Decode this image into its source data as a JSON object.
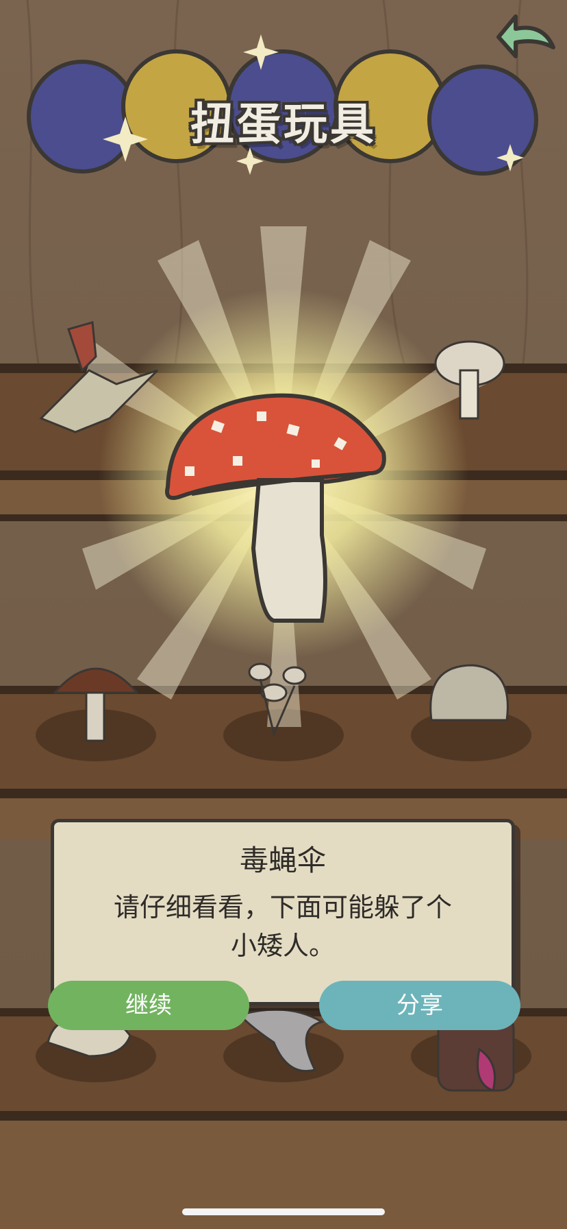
{
  "header": {
    "title": "扭蛋玩具"
  },
  "navigation": {
    "back_icon": "back-arrow-icon",
    "back_color": "#8cc79a"
  },
  "featured_item": {
    "name": "毒蝇伞",
    "icon": "fly-agaric-mushroom-icon",
    "cap_color": "#d8533a"
  },
  "popup": {
    "title": "毒蝇伞",
    "description_line1": "请仔细看看，下面可能躲了个",
    "description_line2": "小矮人。"
  },
  "buttons": {
    "continue_label": "继续",
    "continue_color": "#72b360",
    "share_label": "分享",
    "share_color": "#6cb4ba"
  },
  "shelf_items": [
    {
      "icon": "pterodactyl-icon"
    },
    {
      "icon": "white-mushroom-icon"
    },
    {
      "icon": "shiitake-mushroom-icon"
    },
    {
      "icon": "enoki-cluster-mushroom-icon"
    },
    {
      "icon": "lions-mane-mushroom-icon"
    },
    {
      "icon": "coral-mushroom-icon"
    },
    {
      "icon": "oyster-mushroom-icon"
    },
    {
      "icon": "tiki-mask-icon"
    }
  ]
}
